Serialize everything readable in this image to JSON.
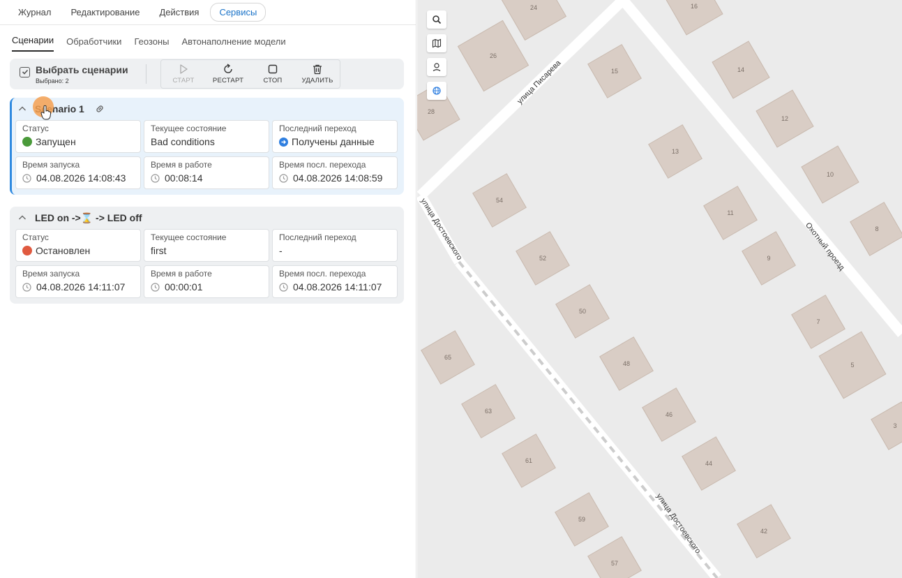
{
  "topnav": {
    "tabs": [
      "Журнал",
      "Редактирование",
      "Действия",
      "Сервисы"
    ],
    "active": "Сервисы"
  },
  "subnav": {
    "tabs": [
      "Сценарии",
      "Обработчики",
      "Геозоны",
      "Автонаполнение модели"
    ],
    "active": "Сценарии"
  },
  "toolbar": {
    "select_title": "Выбрать сценарии",
    "select_count": "Выбрано: 2",
    "start": "СТАРТ",
    "restart": "РЕСТАРТ",
    "stop": "СТОП",
    "delete": "УДАЛИТЬ"
  },
  "scenarios": [
    {
      "title": "Scenario 1",
      "status_label": "Статус",
      "status": "Запущен",
      "status_color": "#4a9a3a",
      "state_label": "Текущее состояние",
      "state": "Bad conditions",
      "last_label": "Последний переход",
      "last": "Получены данные",
      "start_label": "Время запуска",
      "start_time": "04.08.2026 14:08:43",
      "work_label": "Время в работе",
      "work_time": "00:08:14",
      "trans_label": "Время посл. перехода",
      "trans_time": "04.08.2026 14:08:59"
    },
    {
      "title": "LED on ->⌛ -> LED off",
      "status_label": "Статус",
      "status": "Остановлен",
      "status_color": "#e05a40",
      "state_label": "Текущее состояние",
      "state": "first",
      "last_label": "Последний переход",
      "last": "-",
      "start_label": "Время запуска",
      "start_time": "04.08.2026 14:11:07",
      "work_label": "Время в работе",
      "work_time": "00:00:01",
      "trans_label": "Время посл. перехода",
      "trans_time": "04.08.2026 14:11:07"
    }
  ],
  "map": {
    "street_labels": [
      "улица Писарева",
      "улица Достоевского",
      "улица Достоевского",
      "Охотный проезд"
    ],
    "house_numbers": [
      "24",
      "16",
      "26",
      "15",
      "14",
      "28",
      "12",
      "13",
      "10",
      "54",
      "11",
      "8",
      "52",
      "9",
      "50",
      "7",
      "48",
      "5",
      "65",
      "46",
      "63",
      "3",
      "61",
      "44",
      "59",
      "42",
      "57"
    ]
  }
}
